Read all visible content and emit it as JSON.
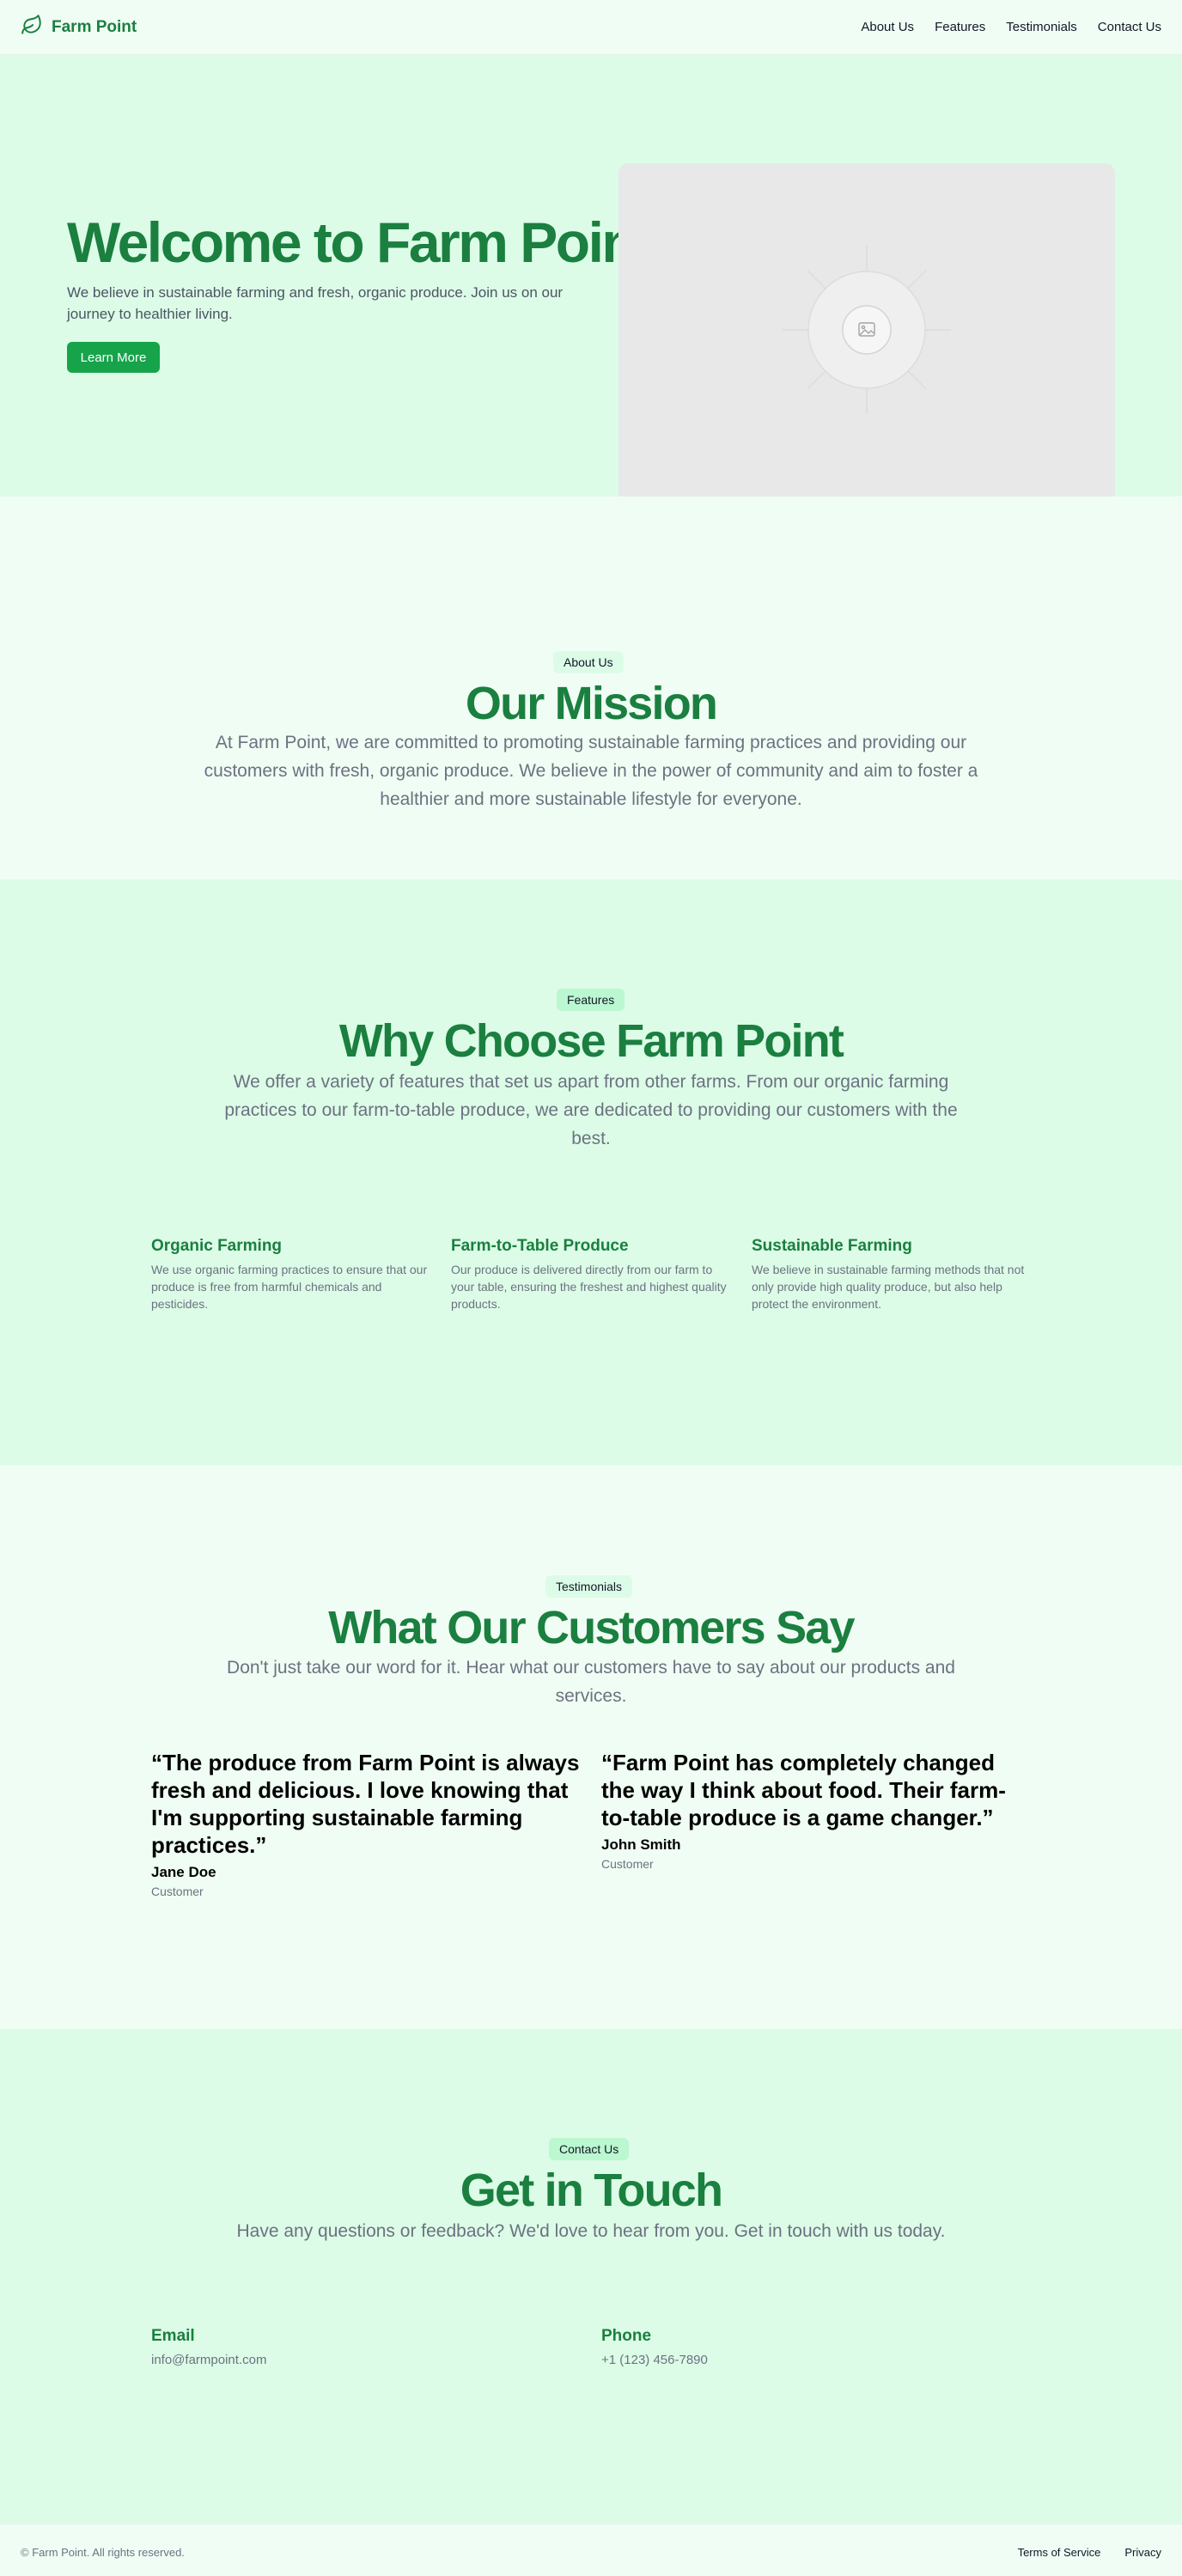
{
  "colors": {
    "brand_green": "#1a7f3f",
    "button_green": "#16a34a",
    "light_bg": "#f0fdf4",
    "mint_bg": "#dcfce7"
  },
  "header": {
    "brand": "Farm Point",
    "brand_icon": "leaf-icon",
    "nav": [
      "About Us",
      "Features",
      "Testimonials",
      "Contact Us"
    ]
  },
  "hero": {
    "title": "Welcome to Farm Point",
    "description": "We believe in sustainable farming and fresh, organic produce. Join us on our journey to healthier living.",
    "button": "Learn More",
    "image_icon": "image-placeholder-icon"
  },
  "about": {
    "badge": "About Us",
    "title": "Our Mission",
    "description": "At Farm Point, we are committed to promoting sustainable farming practices and providing our customers with fresh, organic produce. We believe in the power of community and aim to foster a healthier and more sustainable lifestyle for everyone."
  },
  "features": {
    "badge": "Features",
    "title": "Why Choose Farm Point",
    "description": "We offer a variety of features that set us apart from other farms. From our organic farming practices to our farm-to-table produce, we are dedicated to providing our customers with the best.",
    "items": [
      {
        "title": "Organic Farming",
        "description": "We use organic farming practices to ensure that our produce is free from harmful chemicals and pesticides."
      },
      {
        "title": "Farm-to-Table Produce",
        "description": "Our produce is delivered directly from our farm to your table, ensuring the freshest and highest quality products."
      },
      {
        "title": "Sustainable Farming",
        "description": "We believe in sustainable farming methods that not only provide high quality produce, but also help protect the environment."
      }
    ]
  },
  "testimonials": {
    "badge": "Testimonials",
    "title": "What Our Customers Say",
    "description": "Don't just take our word for it. Hear what our customers have to say about our products and services.",
    "items": [
      {
        "quote": "“The produce from Farm Point is always fresh and delicious. I love knowing that I'm supporting sustainable farming practices.”",
        "author": "Jane Doe",
        "role": "Customer"
      },
      {
        "quote": "“Farm Point has completely changed the way I think about food. Their farm-to-table produce is a game changer.”",
        "author": "John Smith",
        "role": "Customer"
      }
    ]
  },
  "contact": {
    "badge": "Contact Us",
    "title": "Get in Touch",
    "description": "Have any questions or feedback? We'd love to hear from you. Get in touch with us today.",
    "email_label": "Email",
    "email": "info@farmpoint.com",
    "phone_label": "Phone",
    "phone": "+1 (123) 456-7890"
  },
  "footer": {
    "copyright": "© Farm Point. All rights reserved.",
    "links": [
      "Terms of Service",
      "Privacy"
    ]
  }
}
